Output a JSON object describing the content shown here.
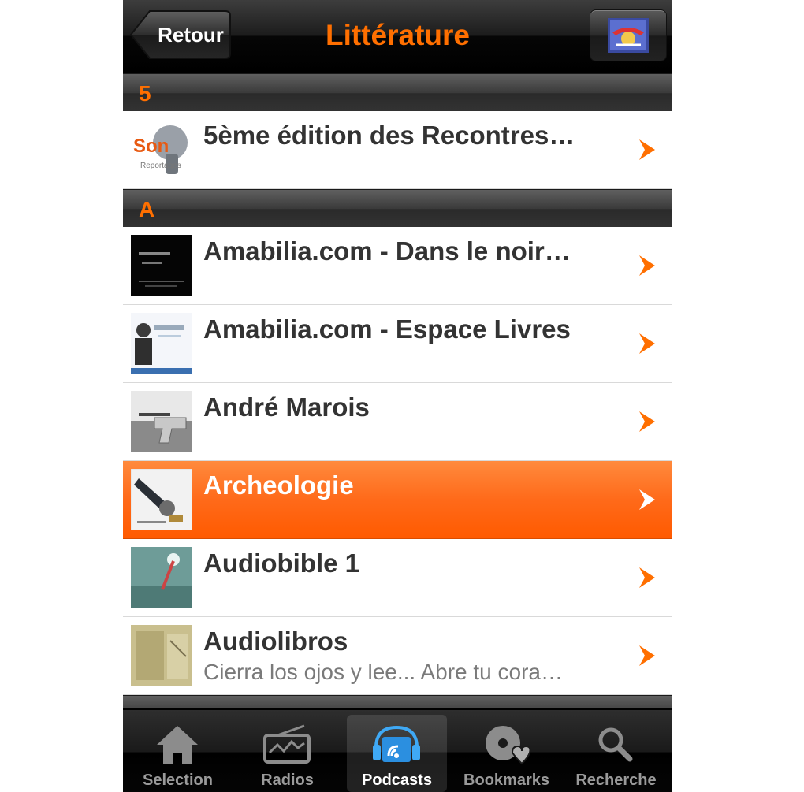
{
  "nav": {
    "back_label": "Retour",
    "title": "Littérature",
    "logo_icon": "podcast-logo-icon"
  },
  "sections": [
    {
      "letter": "5"
    },
    {
      "letter": "A"
    }
  ],
  "rows": [
    {
      "title": "5ème édition des Recontres…",
      "subtitle": ""
    },
    {
      "title": "Amabilia.com - Dans le noir…",
      "subtitle": ""
    },
    {
      "title": "Amabilia.com - Espace Livres",
      "subtitle": ""
    },
    {
      "title": "André Marois",
      "subtitle": ""
    },
    {
      "title": "Archeologie",
      "subtitle": "",
      "selected": true
    },
    {
      "title": "Audiobible 1",
      "subtitle": ""
    },
    {
      "title": "Audiolibros",
      "subtitle": "Cierra los ojos y lee... Abre tu cora…"
    }
  ],
  "tabs": [
    {
      "label": "Selection",
      "icon": "home-icon"
    },
    {
      "label": "Radios",
      "icon": "radio-icon"
    },
    {
      "label": "Podcasts",
      "icon": "podcast-icon",
      "active": true
    },
    {
      "label": "Bookmarks",
      "icon": "bookmark-heart-icon"
    },
    {
      "label": "Recherche",
      "icon": "search-icon"
    }
  ],
  "colors": {
    "accent": "#ff6f00",
    "selected_row": "#ff6a1a",
    "bar": "#1a1a1a"
  }
}
